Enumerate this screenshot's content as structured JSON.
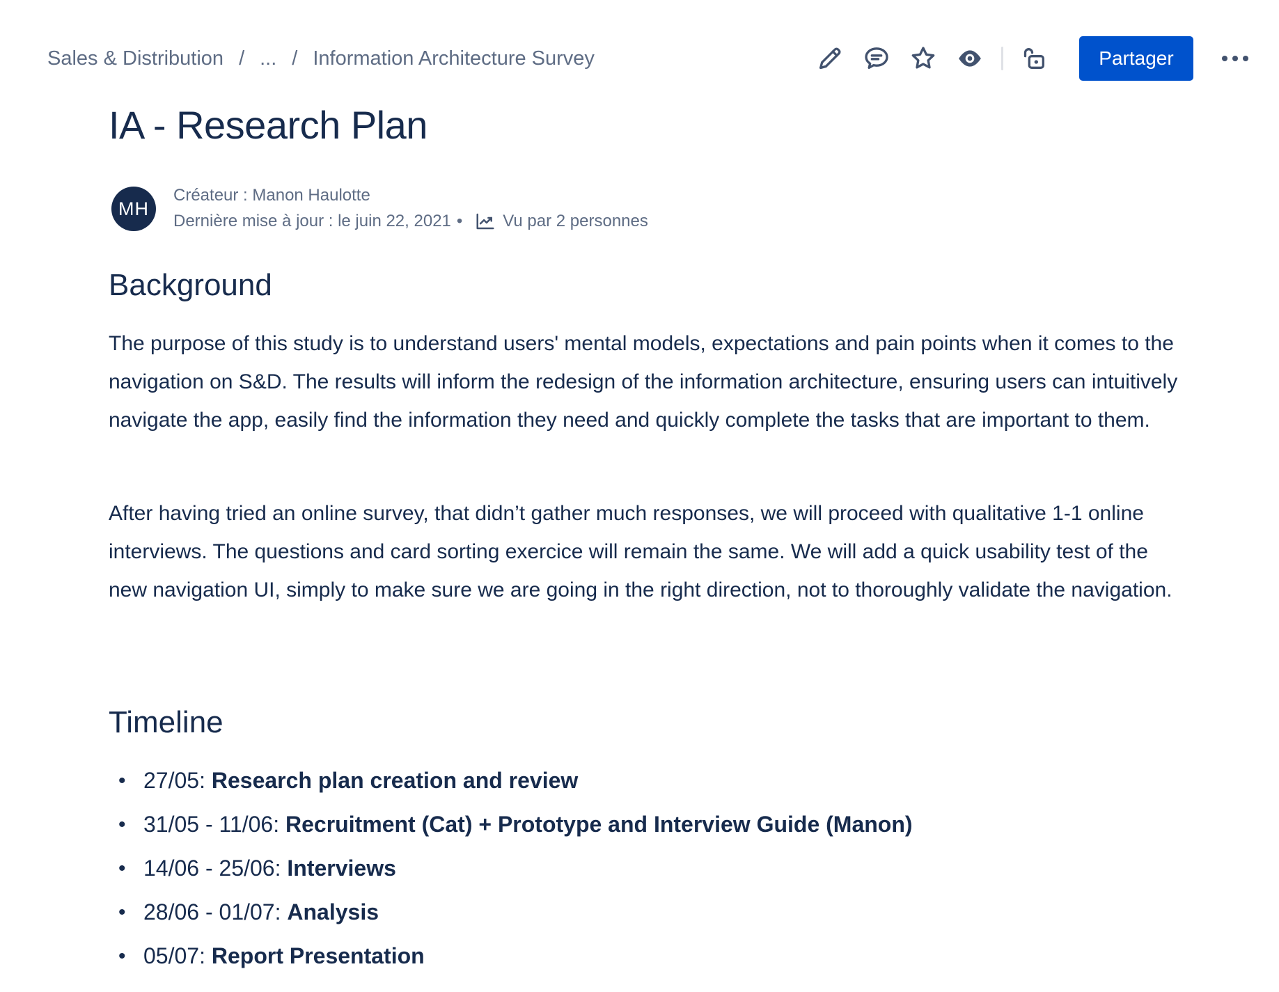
{
  "breadcrumb": {
    "items": [
      "Sales & Distribution",
      "...",
      "Information Architecture Survey"
    ],
    "separator": "/"
  },
  "toolbar": {
    "icons": [
      "edit-icon",
      "comment-icon",
      "star-icon",
      "watch-icon",
      "unlock-icon",
      "more-icon"
    ],
    "share_label": "Partager",
    "accent_color": "#0052cc"
  },
  "page": {
    "title": "IA - Research Plan"
  },
  "byline": {
    "avatar_initials": "MH",
    "creator": "Créateur : Manon Haulotte",
    "last_updated": "Dernière mise à jour : le juin 22, 2021",
    "dot": "•",
    "views": "Vu par 2 personnes"
  },
  "background": {
    "heading": "Background",
    "paragraph1": "The purpose of this study is to understand users' mental models, expectations and pain points when it comes to the navigation on S&D. The results will inform the redesign of the information architecture, ensuring users can intuitively navigate the app, easily find the information they need and quickly complete the tasks that are important to them.",
    "paragraph2": "After having tried an online survey, that didn’t gather much responses, we will proceed with qualitative 1-1 online interviews. The questions and card sorting exercice will remain the same. We will add a quick usability test of the new navigation UI, simply to make sure we are going in the right direction, not to thoroughly validate the navigation."
  },
  "timeline": {
    "heading": "Timeline",
    "items": [
      {
        "date": "27/05: ",
        "task": "Research plan creation and review"
      },
      {
        "date": "31/05 - 11/06: ",
        "task": "Recruitment (Cat) + Prototype and Interview Guide (Manon)"
      },
      {
        "date": "14/06 - 25/06: ",
        "task": "Interviews"
      },
      {
        "date": "28/06 - 01/07: ",
        "task": "Analysis"
      },
      {
        "date": "05/07: ",
        "task": "Report Presentation"
      }
    ]
  }
}
